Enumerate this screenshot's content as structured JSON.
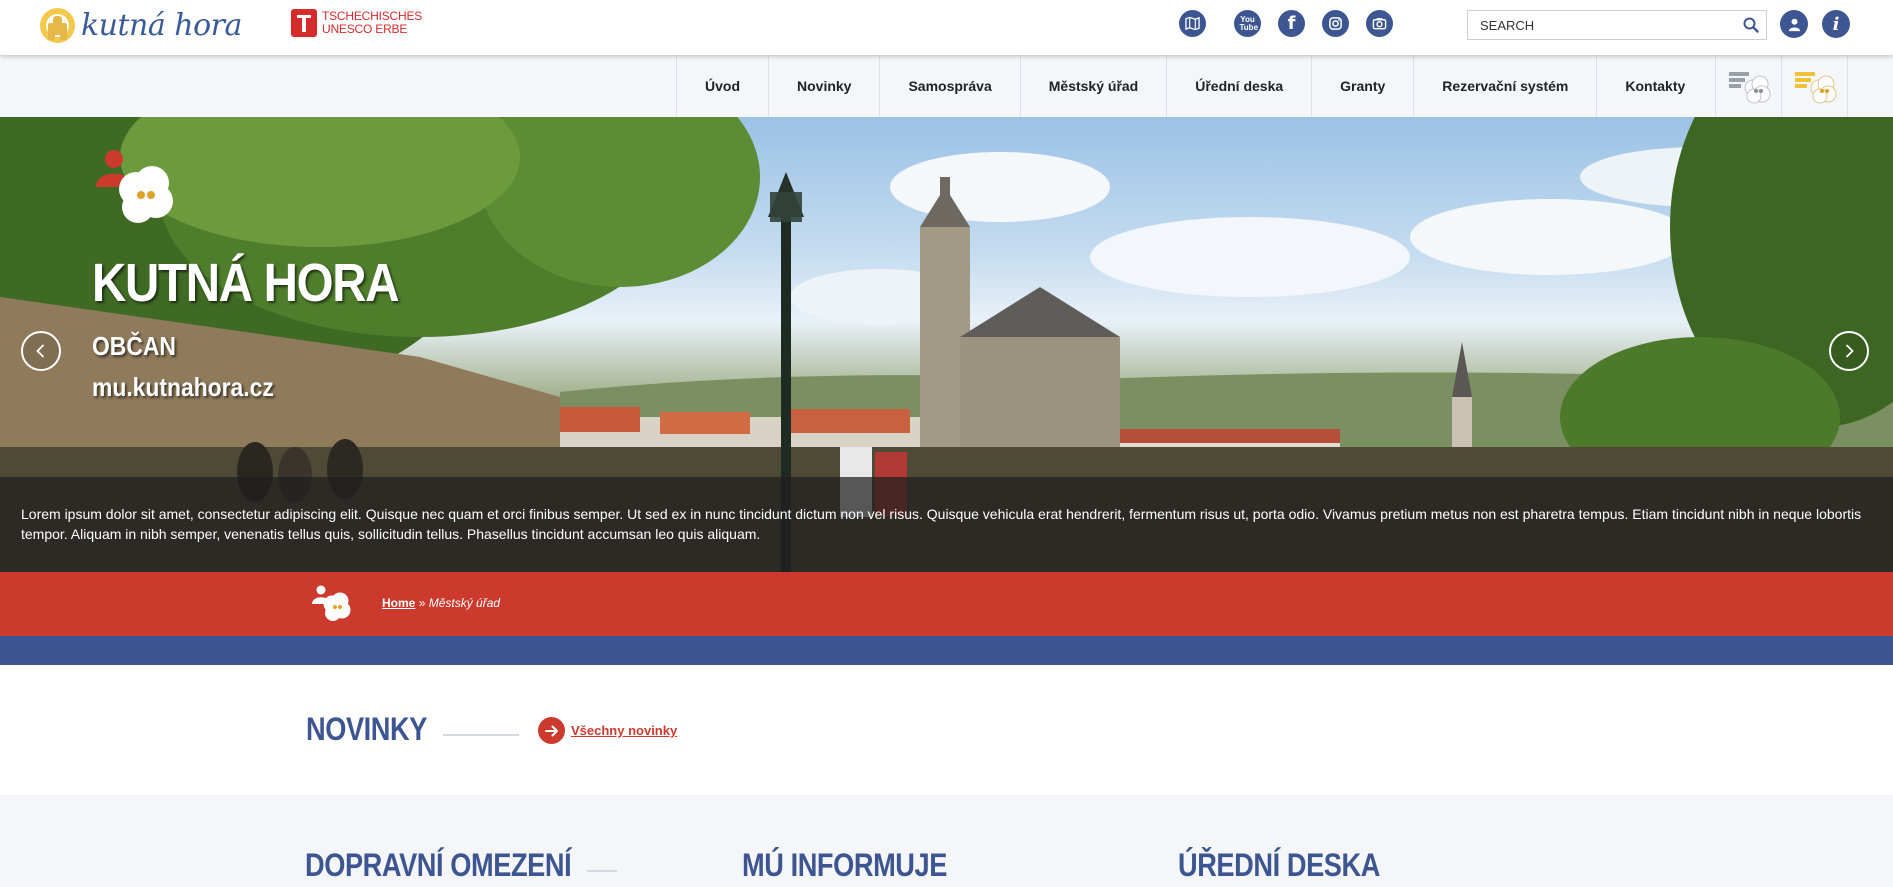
{
  "header": {
    "logo_text": "kutná hora",
    "unesco_line1": "TSCHECHISCHES",
    "unesco_line2": "UNESCO ERBE",
    "social": [
      "map-icon",
      "youtube-icon",
      "facebook-icon",
      "instagram-icon",
      "camera-icon"
    ],
    "youtube_label": "You Tube",
    "facebook_label": "f",
    "search_placeholder": "SEARCH",
    "user_icon": "user-icon",
    "info_label": "i"
  },
  "nav": {
    "items": [
      "Úvod",
      "Novinky",
      "Samospráva",
      "Městský úřad",
      "Úřední deska",
      "Granty",
      "Rezervační systém",
      "Kontakty"
    ]
  },
  "hero": {
    "title": "KUTNÁ HORA",
    "subtitle": "OBČAN",
    "url": "mu.kutnahora.cz",
    "caption": "Lorem ipsum dolor sit amet, consectetur adipiscing elit. Quisque nec quam et orci finibus semper. Ut sed ex in nunc tincidunt dictum non vel risus. Quisque vehicula erat hendrerit, fermentum risus ut, porta odio. Vivamus pretium metus non est pharetra tempus. Etiam tincidunt nibh in neque lobortis tempor. Aliquam in nibh semper, venenatis tellus quis, sollicitudin tellus. Phasellus tincidunt accumsan leo quis aliquam."
  },
  "breadcrumb": {
    "home": "Home",
    "separator": "»",
    "current": "Městský úřad"
  },
  "novinky": {
    "title": "NOVINKY",
    "more_label": "Všechny novinky"
  },
  "bottom": {
    "col1": "DOPRAVNÍ OMEZENÍ",
    "col2": "MÚ INFORMUJE",
    "col3": "ÚŘEDNÍ DESKA"
  },
  "colors": {
    "brand_blue": "#3d5691",
    "brand_red": "#cc3a2e",
    "nav_bg": "#f4f6f9"
  }
}
